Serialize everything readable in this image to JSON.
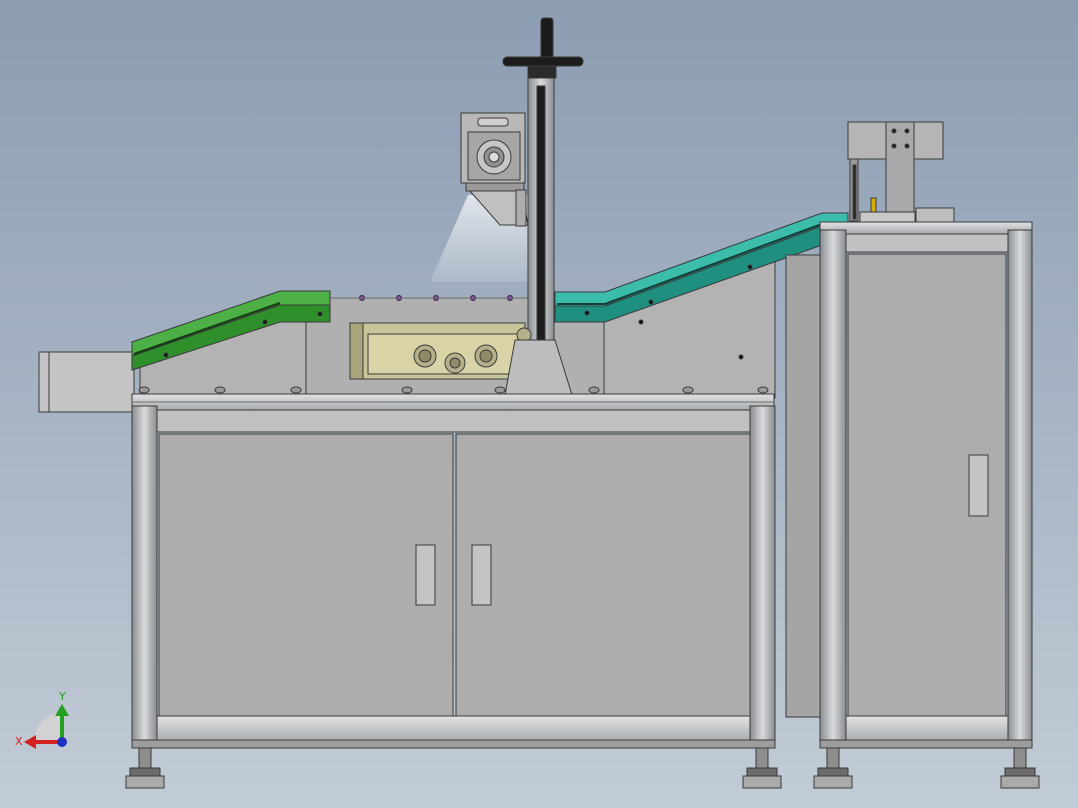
{
  "viewport": {
    "background_top": "#8c9db2",
    "background_bottom": "#c2ccd6"
  },
  "machine": {
    "frame_color": "#b9bcbf",
    "panel_color": "#adadad",
    "outline_color": "#3a3a3a",
    "left_conveyor_color": "#3aa035",
    "right_conveyor_color": "#2aa394",
    "fastener_color": "#7d4ea0"
  },
  "triad": {
    "x_label": "X",
    "y_label": "Y",
    "x_color": "#d42020",
    "y_color": "#22a022",
    "z_color": "#2030c0"
  }
}
